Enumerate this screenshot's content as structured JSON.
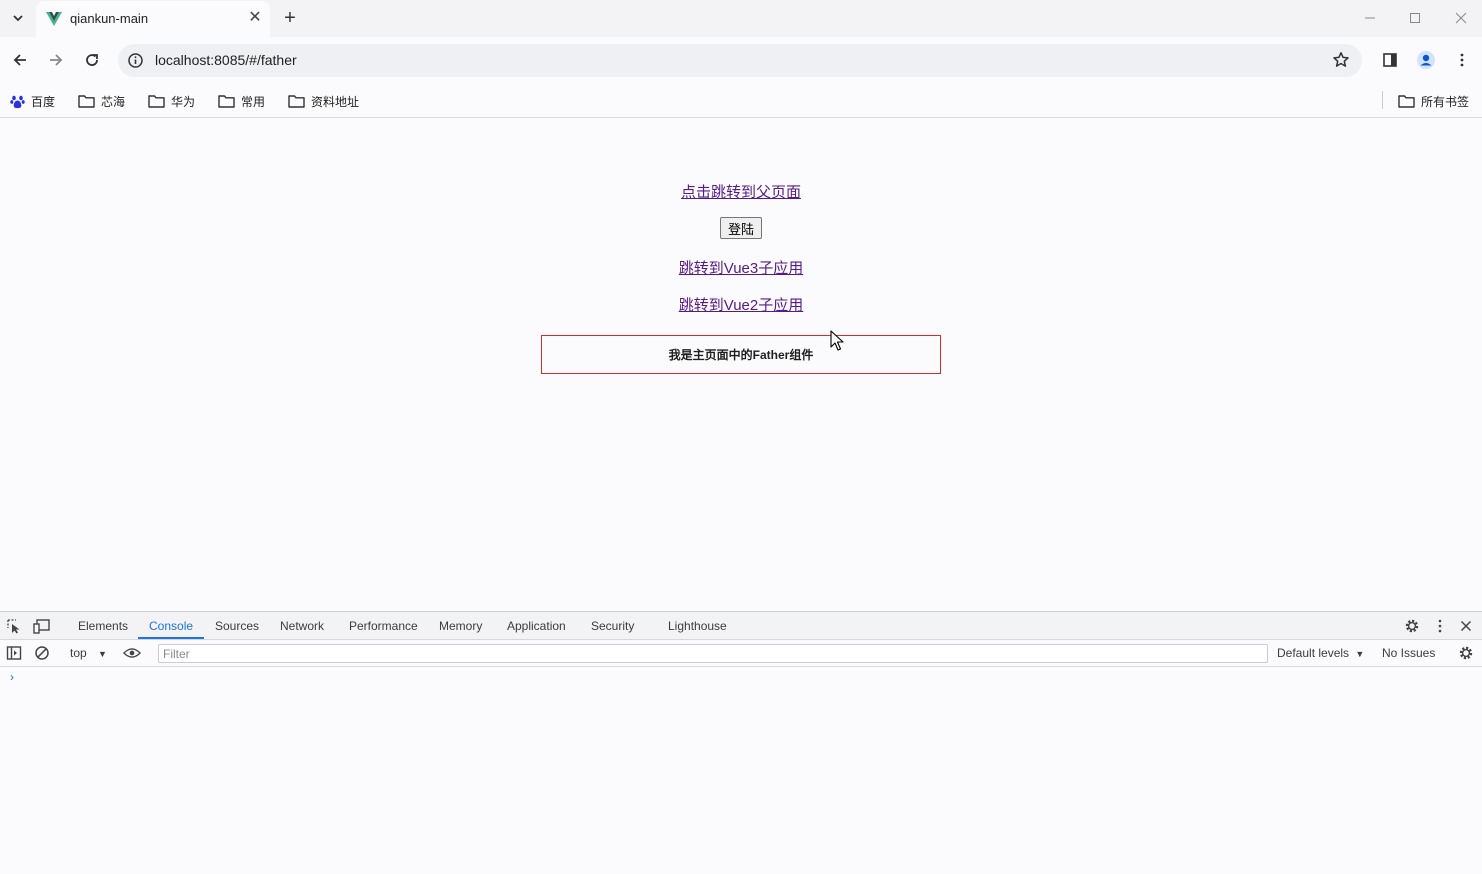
{
  "browser": {
    "tab_title": "qiankun-main",
    "url": "localhost:8085/#/father",
    "bookmarks": [
      "百度",
      "芯海",
      "华为",
      "常用",
      "资料地址"
    ],
    "all_bookmarks_label": "所有书签"
  },
  "page": {
    "link_parent": "点击跳转到父页面",
    "login_button": "登陆",
    "link_vue3": "跳转到Vue3子应用",
    "link_vue2": "跳转到Vue2子应用",
    "father_heading": "我是主页面中的Father组件"
  },
  "devtools": {
    "tabs": [
      "Elements",
      "Console",
      "Sources",
      "Network",
      "Performance",
      "Memory",
      "Application",
      "Security",
      "Lighthouse"
    ],
    "active_tab": "Console",
    "context": "top",
    "filter_placeholder": "Filter",
    "levels": "Default levels",
    "issues": "No Issues",
    "prompt": "›"
  },
  "colors": {
    "link": "#551a8b",
    "father_border": "#d32f2f",
    "accent": "#1a73e8"
  }
}
